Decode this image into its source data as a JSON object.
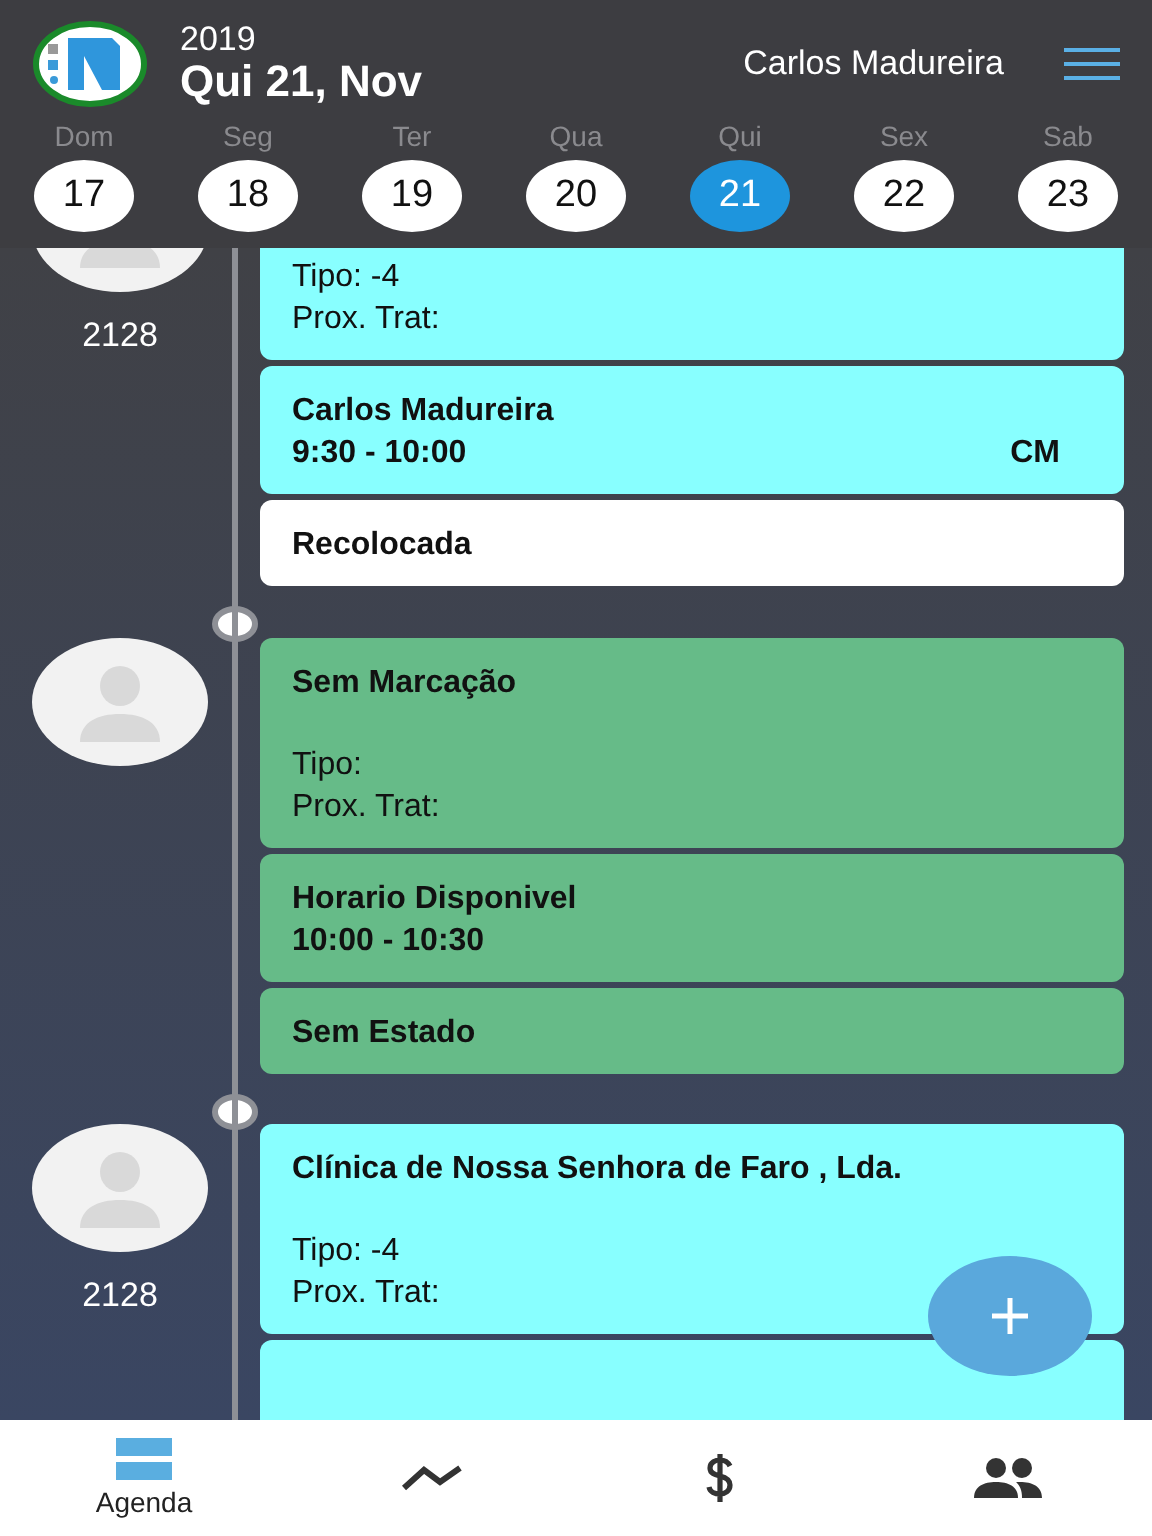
{
  "header": {
    "year": "2019",
    "date": "Qui 21, Nov",
    "user": "Carlos Madureira"
  },
  "week": [
    {
      "day": "Dom",
      "num": "17",
      "selected": false
    },
    {
      "day": "Seg",
      "num": "18",
      "selected": false
    },
    {
      "day": "Ter",
      "num": "19",
      "selected": false
    },
    {
      "day": "Qua",
      "num": "20",
      "selected": false
    },
    {
      "day": "Qui",
      "num": "21",
      "selected": true
    },
    {
      "day": "Sex",
      "num": "22",
      "selected": false
    },
    {
      "day": "Sab",
      "num": "23",
      "selected": false
    }
  ],
  "groups": [
    {
      "number": "2128",
      "color": "#88ffff",
      "info": {
        "tipo": "Tipo: -4",
        "prox": "Prox. Trat:"
      },
      "slot": {
        "name": "Carlos Madureira",
        "time": "9:30 - 10:00",
        "initials": "CM"
      },
      "status": {
        "label": "Recolocada",
        "color": "#ffffff"
      }
    },
    {
      "color": "#66bb88",
      "info": {
        "title": "Sem Marcação",
        "tipo": "Tipo:",
        "prox": "Prox. Trat:"
      },
      "slot": {
        "name": "Horario Disponivel",
        "time": "10:00 - 10:30"
      },
      "status": {
        "label": "Sem Estado",
        "color": "#66bb88"
      }
    },
    {
      "number": "2128",
      "color": "#88ffff",
      "info": {
        "title": "Clínica de Nossa Senhora de Faro , Lda.",
        "tipo": "Tipo: -4",
        "prox": "Prox. Trat:"
      }
    }
  ],
  "nav": [
    {
      "kind": "agenda",
      "label": "Agenda",
      "selected": true
    },
    {
      "kind": "chart",
      "selected": false
    },
    {
      "kind": "money",
      "selected": false
    },
    {
      "kind": "people",
      "selected": false
    }
  ]
}
